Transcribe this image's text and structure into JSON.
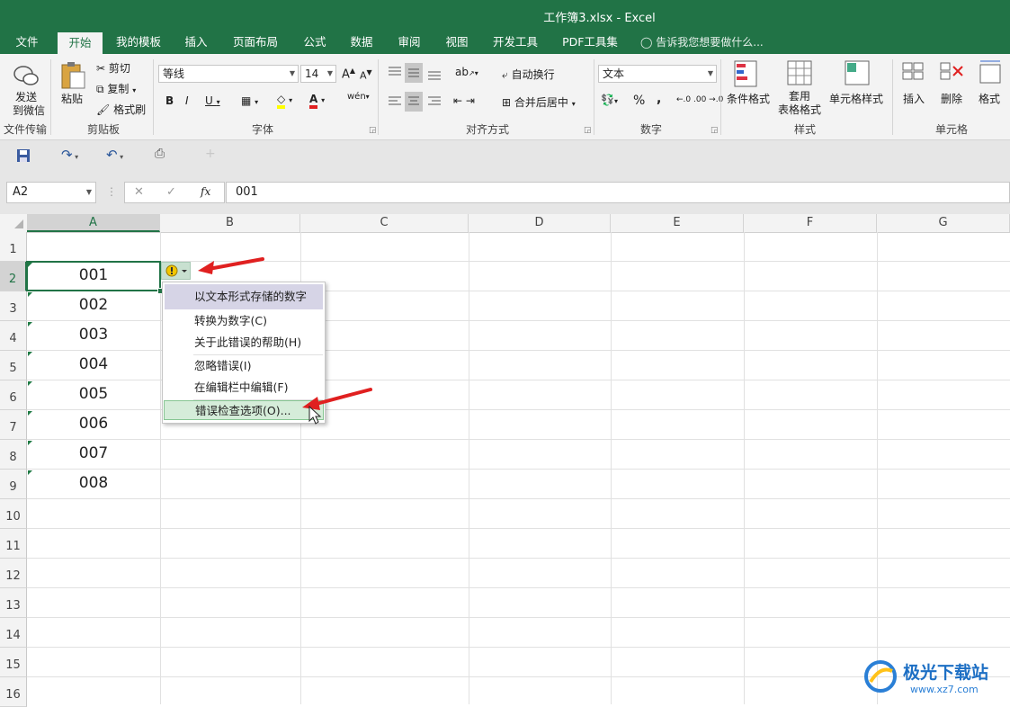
{
  "window": {
    "title": "工作簿3.xlsx - Excel"
  },
  "tabs": [
    "文件",
    "开始",
    "我的模板",
    "插入",
    "页面布局",
    "公式",
    "数据",
    "审阅",
    "视图",
    "开发工具",
    "PDF工具集"
  ],
  "active_tab": "开始",
  "tell_me": "告诉我您想要做什么...",
  "ribbon": {
    "file_transfer": {
      "button": "发送到微信",
      "button_l1": "发送",
      "button_l2": "到微信",
      "group": "文件传输"
    },
    "clipboard": {
      "paste": "粘贴",
      "cut": "剪切",
      "copy": "复制",
      "format_painter": "格式刷",
      "group": "剪贴板"
    },
    "font": {
      "name": "等线",
      "size": "14",
      "group": "字体"
    },
    "alignment": {
      "wrap": "自动换行",
      "merge": "合并后居中",
      "group": "对齐方式"
    },
    "number": {
      "format": "文本",
      "percent": "%",
      "comma": ",",
      "group": "数字"
    },
    "styles": {
      "conditional_l1": "条件格式",
      "table_l1": "套用",
      "table_l2": "表格格式",
      "cell_styles": "单元格样式",
      "group": "样式"
    },
    "cells": {
      "insert": "插入",
      "delete": "删除",
      "format": "格式",
      "group": "单元格"
    }
  },
  "formula_bar": {
    "name_box": "A2",
    "fx": "fx",
    "formula": "001"
  },
  "columns": [
    "A",
    "B",
    "C",
    "D",
    "E",
    "F",
    "G"
  ],
  "rows": [
    "1",
    "2",
    "3",
    "4",
    "5",
    "6",
    "7",
    "8",
    "9",
    "10",
    "11",
    "12",
    "13",
    "14",
    "15",
    "16"
  ],
  "cells_A": [
    "",
    "001",
    "002",
    "003",
    "004",
    "005",
    "006",
    "007",
    "008"
  ],
  "error_menu": {
    "header": "以文本形式存储的数字",
    "items": [
      "转换为数字(C)",
      "关于此错误的帮助(H)",
      "忽略错误(I)",
      "在编辑栏中编辑(F)",
      "错误检查选项(O)..."
    ]
  },
  "watermark": {
    "brand": "极光下载站",
    "url": "www.xz7.com"
  },
  "colors": {
    "excel_green": "#217346",
    "arrow_red": "#e02020"
  }
}
